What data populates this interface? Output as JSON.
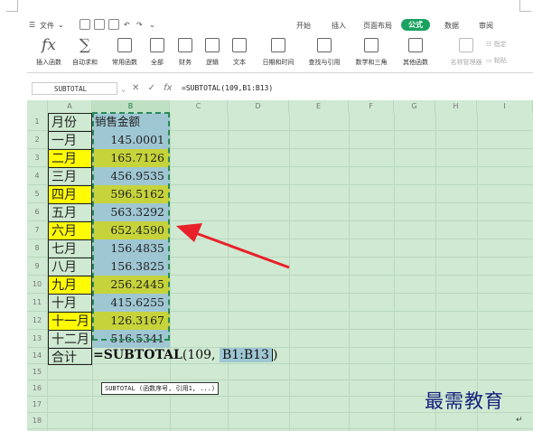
{
  "menu": {
    "file": "文件",
    "tabs": [
      "开始",
      "插入",
      "页面布局",
      "公式",
      "数据",
      "审阅"
    ],
    "active_tab": "公式"
  },
  "ribbon": {
    "items": [
      {
        "label": "插入函数",
        "icon": "fx-icon"
      },
      {
        "label": "自动求和",
        "icon": "sigma-icon"
      },
      {
        "label": "常用函数",
        "icon": "function-box-icon"
      },
      {
        "label": "全部",
        "icon": "function-box-icon"
      },
      {
        "label": "财务",
        "icon": "finance-icon"
      },
      {
        "label": "逻辑",
        "icon": "logic-icon"
      },
      {
        "label": "文本",
        "icon": "text-icon"
      },
      {
        "label": "日期和时间",
        "icon": "date-icon"
      },
      {
        "label": "查找与引用",
        "icon": "lookup-icon"
      },
      {
        "label": "数学和三角",
        "icon": "math-icon"
      },
      {
        "label": "其他函数",
        "icon": "other-functions-icon"
      },
      {
        "label": "名称管理器",
        "icon": "name-manager-icon"
      },
      {
        "label": "粘贴",
        "icon": "paste-icon"
      },
      {
        "label": "指定",
        "icon": "specify-icon"
      }
    ]
  },
  "formula_bar": {
    "name_box": "SUBTOTAL",
    "formula": "=SUBTOTAL(109,B1:B13)"
  },
  "columns": [
    "A",
    "B",
    "C",
    "D",
    "E",
    "F",
    "G",
    "H",
    "I"
  ],
  "rows": [
    {
      "num": "1",
      "a": "月份",
      "b": "销售金额",
      "a_fill": "none"
    },
    {
      "num": "2",
      "a": "一月",
      "b": "145.0001",
      "a_fill": "none"
    },
    {
      "num": "3",
      "a": "二月",
      "b": "165.7126",
      "a_fill": "yellow"
    },
    {
      "num": "4",
      "a": "三月",
      "b": "456.9535",
      "a_fill": "none"
    },
    {
      "num": "5",
      "a": "四月",
      "b": "596.5162",
      "a_fill": "yellow"
    },
    {
      "num": "6",
      "a": "五月",
      "b": "563.3292",
      "a_fill": "none"
    },
    {
      "num": "7",
      "a": "六月",
      "b": "652.4590",
      "a_fill": "yellow"
    },
    {
      "num": "8",
      "a": "七月",
      "b": "156.4835",
      "a_fill": "none"
    },
    {
      "num": "9",
      "a": "八月",
      "b": "156.3825",
      "a_fill": "none"
    },
    {
      "num": "10",
      "a": "九月",
      "b": "256.2445",
      "a_fill": "yellow"
    },
    {
      "num": "11",
      "a": "十月",
      "b": "415.6255",
      "a_fill": "none"
    },
    {
      "num": "12",
      "a": "十一月",
      "b": "126.3167",
      "a_fill": "yellow"
    },
    {
      "num": "13",
      "a": "十二月",
      "b": "516.5341",
      "a_fill": "none"
    },
    {
      "num": "14",
      "a": "合计",
      "b": "",
      "a_fill": "none"
    },
    {
      "num": "15",
      "a": "",
      "b": "",
      "a_fill": "none"
    },
    {
      "num": "16",
      "a": "",
      "b": "",
      "a_fill": "none"
    },
    {
      "num": "17",
      "a": "",
      "b": "",
      "a_fill": "none"
    },
    {
      "num": "18",
      "a": "",
      "b": "",
      "a_fill": "none"
    }
  ],
  "editing_cell": {
    "prefix": "=SUBTOTAL",
    "open_args": "(109,",
    "range": "B1:B13",
    "close": ")"
  },
  "tooltip": "SUBTOTAL (函数序号, 引用1, ...)",
  "watermark": "最需教育",
  "colors": {
    "grid_bg": "#cfe9d2",
    "yellow_fill": "#fffb05",
    "blue_fill": "#9fc7d3",
    "olive_fill": "#c6d33a",
    "arrow": "#e8212b",
    "active_tab": "#1aa260",
    "watermark": "#16207d"
  }
}
